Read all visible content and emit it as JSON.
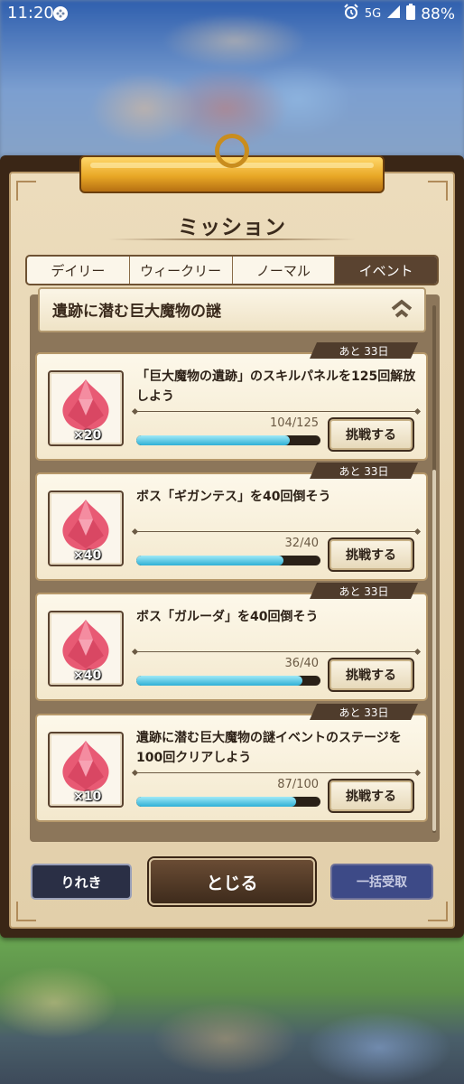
{
  "status_bar": {
    "time": "11:20",
    "network": "5G",
    "battery": "88%"
  },
  "dialog": {
    "title": "ミッション",
    "tabs": [
      {
        "label": "デイリー",
        "active": false
      },
      {
        "label": "ウィークリー",
        "active": false
      },
      {
        "label": "ノーマル",
        "active": false
      },
      {
        "label": "イベント",
        "active": true
      }
    ],
    "section_title": "遺跡に潜む巨大魔物の謎",
    "missions": [
      {
        "deadline": "あと 33日",
        "reward_qty": "×20",
        "text": "「巨大魔物の遺跡」のスキルパネルを125回解放しよう",
        "progress_text": "104/125",
        "progress": 0.832,
        "button": "挑戦する"
      },
      {
        "deadline": "あと 33日",
        "reward_qty": "×40",
        "text": "ボス「ギガンテス」を40回倒そう",
        "progress_text": "32/40",
        "progress": 0.8,
        "button": "挑戦する"
      },
      {
        "deadline": "あと 33日",
        "reward_qty": "×40",
        "text": "ボス「ガルーダ」を40回倒そう",
        "progress_text": "36/40",
        "progress": 0.9,
        "button": "挑戦する"
      },
      {
        "deadline": "あと 33日",
        "reward_qty": "×10",
        "text": "遺跡に潜む巨大魔物の謎イベントのステージを100回クリアしよう",
        "progress_text": "87/100",
        "progress": 0.87,
        "button": "挑戦する"
      }
    ],
    "buttons": {
      "history": "りれき",
      "close": "とじる",
      "bulk_receive": "一括受取"
    }
  },
  "colors": {
    "active_tab": "#5a4330",
    "progress_fill": "#2fb0d6",
    "gem": "#e85a74",
    "bulk_button": "#3d4a87"
  },
  "icons": {
    "reward": "gem-icon",
    "collapse": "chevron-up-double-icon"
  }
}
